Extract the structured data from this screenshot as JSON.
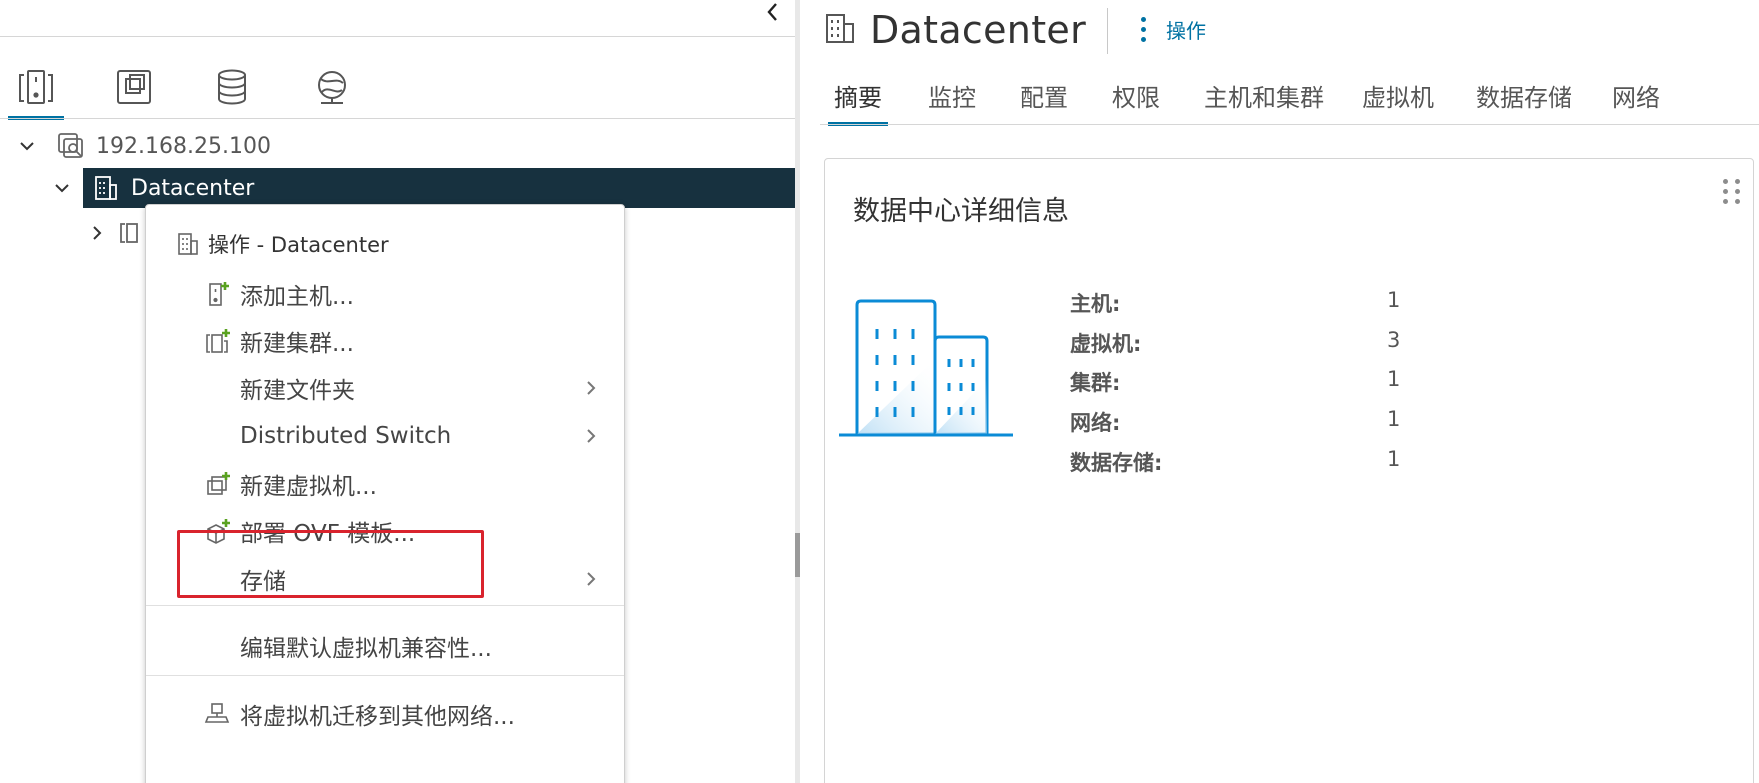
{
  "navigator": {
    "collapse_icon": "chevron-left-icon",
    "tabs": [
      {
        "name": "hosts-and-clusters",
        "icon": "hosts-clusters-icon",
        "active": true
      },
      {
        "name": "vms-and-templates",
        "icon": "vms-templates-icon",
        "active": false
      },
      {
        "name": "storage",
        "icon": "storage-icon",
        "active": false
      },
      {
        "name": "networking",
        "icon": "network-icon",
        "active": false
      }
    ],
    "tree": {
      "vcenter": "192.168.25.100",
      "datacenter": "Datacenter"
    }
  },
  "context_menu": {
    "header": "操作 - Datacenter",
    "items": [
      {
        "label": "添加主机...",
        "icon": "add-host-icon"
      },
      {
        "label": "新建集群...",
        "icon": "new-cluster-icon"
      },
      {
        "label": "新建文件夹",
        "submenu": true
      },
      {
        "label": "Distributed Switch",
        "submenu": true
      },
      {
        "label": "新建虚拟机...",
        "icon": "new-vm-icon"
      },
      {
        "label": "部署 OVF 模板...",
        "icon": "deploy-ovf-icon",
        "highlighted": true
      },
      {
        "label": "存储",
        "submenu": true
      },
      {
        "label": "编辑默认虚拟机兼容性..."
      },
      {
        "label": "将虚拟机迁移到其他网络...",
        "icon": "migrate-vm-network-icon"
      }
    ],
    "highlight_color": "#d9232d"
  },
  "main": {
    "title": "Datacenter",
    "actions_label": "操作",
    "tabs": [
      "摘要",
      "监控",
      "配置",
      "权限",
      "主机和集群",
      "虚拟机",
      "数据存储",
      "网络"
    ],
    "active_tab": "摘要",
    "card": {
      "title": "数据中心详细信息",
      "details": [
        {
          "label": "主机:",
          "value": "1"
        },
        {
          "label": "虚拟机:",
          "value": "3"
        },
        {
          "label": "集群:",
          "value": "1"
        },
        {
          "label": "网络:",
          "value": "1"
        },
        {
          "label": "数据存储:",
          "value": "1"
        }
      ]
    }
  },
  "colors": {
    "accent": "#0072a3",
    "selected_row_bg": "#17313f",
    "add_badge": "#5aa220",
    "illustration_blue": "#0b8bd6"
  }
}
